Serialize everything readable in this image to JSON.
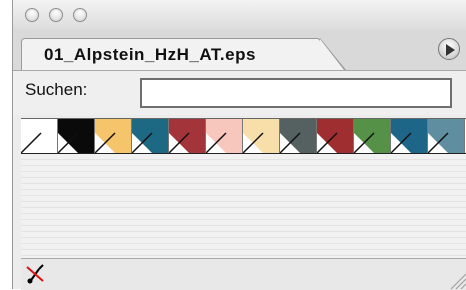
{
  "window": {
    "buttons": [
      "close",
      "minimize",
      "zoom"
    ]
  },
  "tab": {
    "label": "01_Alpstein_HzH_AT.eps"
  },
  "search": {
    "label": "Suchen:",
    "value": "",
    "placeholder": ""
  },
  "swatches": [
    {
      "color": "#ffffff"
    },
    {
      "color": "#0a0a0a"
    },
    {
      "color": "#f6c46a"
    },
    {
      "color": "#1d6883"
    },
    {
      "color": "#a2343a"
    },
    {
      "color": "#f7c7be"
    },
    {
      "color": "#f8dfaa"
    },
    {
      "color": "#556161"
    },
    {
      "color": "#9f2e30"
    },
    {
      "color": "#559146"
    },
    {
      "color": "#1e6688"
    },
    {
      "color": "#5f8ea0"
    }
  ],
  "icons": {
    "menu": "triangle-right-icon",
    "none_swatch": "no-color-icon",
    "resize": "resize-grip-icon"
  }
}
